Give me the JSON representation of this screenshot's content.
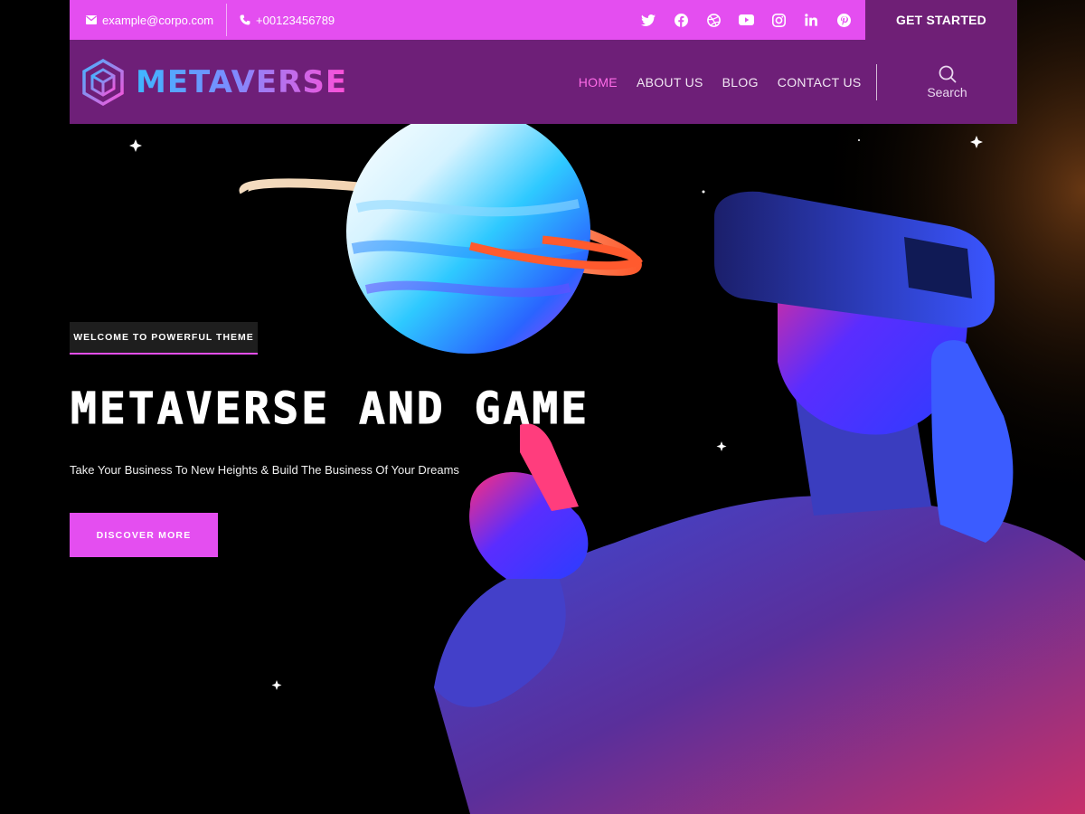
{
  "topbar": {
    "email": "example@corpo.com",
    "phone": "+00123456789",
    "social_icons": [
      "twitter-icon",
      "facebook-icon",
      "dribbble-icon",
      "youtube-icon",
      "instagram-icon",
      "linkedin-icon",
      "pinterest-icon"
    ],
    "cta_label": "GET STARTED"
  },
  "nav": {
    "logo_text": "METAVERSE",
    "items": [
      {
        "label": "HOME",
        "active": true
      },
      {
        "label": "ABOUT US",
        "active": false
      },
      {
        "label": "BLOG",
        "active": false
      },
      {
        "label": "CONTACT US",
        "active": false
      }
    ],
    "search_label": "Search"
  },
  "hero": {
    "badge": "WELCOME TO POWERFUL THEME",
    "title": "METAVERSE AND GAME",
    "subtitle": "Take Your Business To New Heights & Build The Business Of Your Dreams",
    "button_label": "DISCOVER MORE"
  },
  "colors": {
    "accent": "#e44ef0",
    "nav_bg": "#6e1f78",
    "cta_bg": "#6f1f76",
    "active_link": "#ff6be8"
  }
}
